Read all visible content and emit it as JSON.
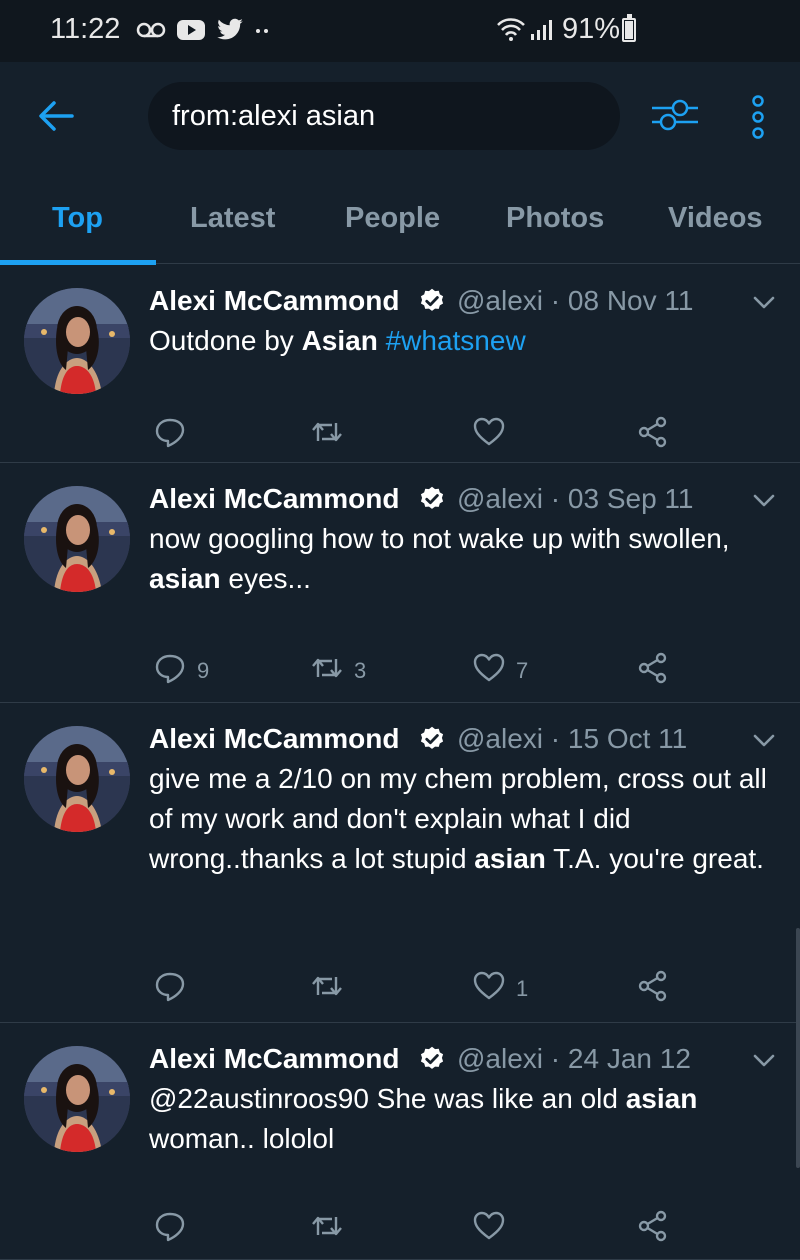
{
  "status_bar": {
    "time": "11:22",
    "battery": "91%",
    "icons": [
      "voicemail-icon",
      "youtube-icon",
      "twitter-icon",
      "more-dots-icon",
      "wifi-icon",
      "signal-icon",
      "battery-icon"
    ]
  },
  "search": {
    "query": "from:alexi asian"
  },
  "tabs": [
    {
      "label": "Top",
      "active": true
    },
    {
      "label": "Latest"
    },
    {
      "label": "People"
    },
    {
      "label": "Photos"
    },
    {
      "label": "Videos"
    }
  ],
  "colors": {
    "background": "#15202b",
    "accent": "#1da1f2",
    "muted": "#8899a6"
  },
  "tweets": [
    {
      "name": "Alexi McCammond",
      "handle": "@alexi",
      "date": "· 08 Nov 11",
      "text_parts": [
        {
          "t": "Outdone by "
        },
        {
          "t": "Asian",
          "b": true
        },
        {
          "t": " "
        },
        {
          "t": "#whatsnew",
          "link": true
        }
      ],
      "replies": "",
      "retweets": "",
      "likes": ""
    },
    {
      "name": "Alexi McCammond",
      "handle": "@alexi",
      "date": "· 03 Sep 11",
      "text_parts": [
        {
          "t": "now googling how to not wake up with swollen, "
        },
        {
          "t": "asian",
          "b": true
        },
        {
          "t": " eyes..."
        }
      ],
      "replies": "9",
      "retweets": "3",
      "likes": "7"
    },
    {
      "name": "Alexi McCammond",
      "handle": "@alexi",
      "date": "· 15 Oct 11",
      "text_parts": [
        {
          "t": "give me a 2/10 on my chem problem, cross out all of my work and don't explain what I did wrong..thanks a lot stupid "
        },
        {
          "t": "asian",
          "b": true
        },
        {
          "t": " T.A. you're great."
        }
      ],
      "replies": "",
      "retweets": "",
      "likes": "1"
    },
    {
      "name": "Alexi McCammond",
      "handle": "@alexi",
      "date": "· 24 Jan 12",
      "text_parts": [
        {
          "t": "@22austinroos90 She was like an old "
        },
        {
          "t": "asian",
          "b": true
        },
        {
          "t": " woman.. lololol"
        }
      ],
      "replies": "",
      "retweets": "",
      "likes": ""
    }
  ]
}
